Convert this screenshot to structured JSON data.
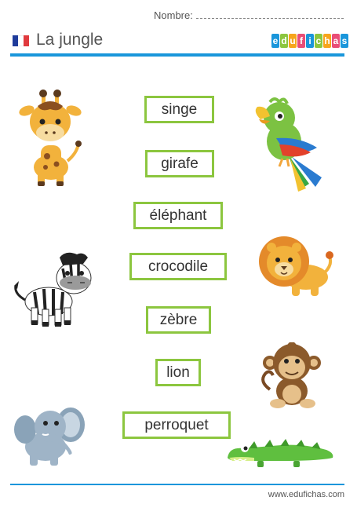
{
  "header": {
    "name_label": "Nombre:",
    "title": "La jungle",
    "flag_colors": [
      "#1f3c9b",
      "#ffffff",
      "#e03a3e"
    ]
  },
  "logo": {
    "text": "edufichas",
    "letters": [
      "e",
      "d",
      "u",
      "f",
      "i",
      "c",
      "h",
      "a",
      "s"
    ],
    "colors": [
      "#1a96db",
      "#8cc63f",
      "#f7a51c",
      "#e94e77",
      "#1a96db",
      "#8cc63f",
      "#f7a51c",
      "#e94e77",
      "#1a96db"
    ]
  },
  "words": [
    "singe",
    "girafe",
    "éléphant",
    "crocodile",
    "zèbre",
    "lion",
    "perroquet"
  ],
  "animals": [
    "giraffe",
    "parrot",
    "zebra",
    "lion",
    "monkey",
    "elephant",
    "crocodile"
  ],
  "footer": {
    "url": "www.edufichas.com"
  },
  "colors": {
    "accent_blue": "#1a96db",
    "box_green": "#8cc63f"
  }
}
